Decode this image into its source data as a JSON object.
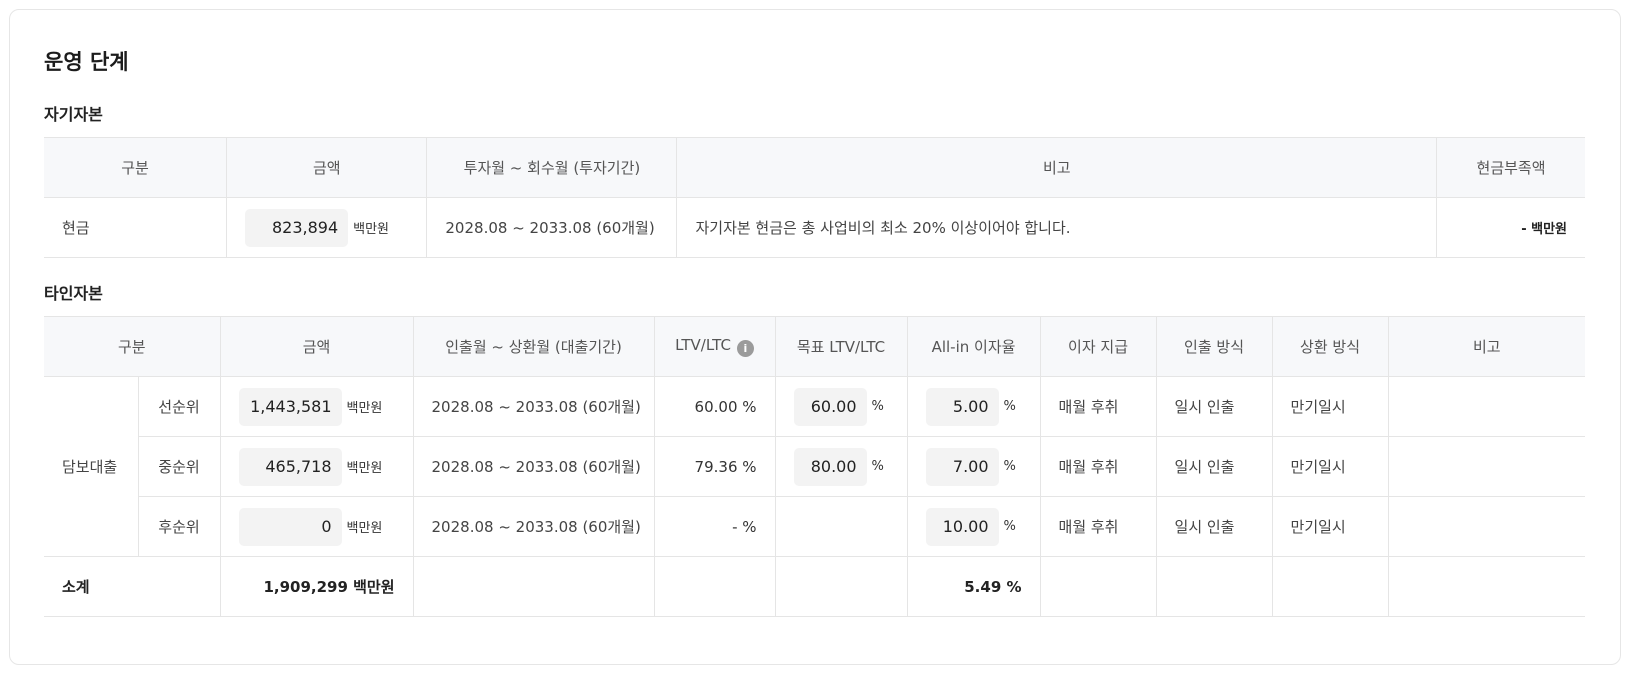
{
  "title": "운영 단계",
  "equity": {
    "section": "자기자본",
    "headers": [
      "구분",
      "금액",
      "투자월 ~ 회수월 (투자기간)",
      "비고",
      "현금부족액"
    ],
    "row": {
      "label": "현금",
      "amount": "823,894",
      "unit": "백만원",
      "period": "2028.08 ~ 2033.08 (60개월)",
      "note": "자기자본 현금은 총 사업비의 최소 20% 이상이어야 합니다.",
      "shortfall": "- 백만원"
    }
  },
  "debt": {
    "section": "타인자본",
    "headers": [
      "구분",
      "금액",
      "인출월 ~ 상환월 (대출기간)",
      "LTV/LTC",
      "목표 LTV/LTC",
      "All-in 이자율",
      "이자 지급",
      "인출 방식",
      "상환 방식",
      "비고"
    ],
    "info_icon": "info-icon",
    "group_label": "담보대출",
    "unit": "백만원",
    "pct": "%",
    "rows": [
      {
        "tranche": "선순위",
        "amount": "1,443,581",
        "period": "2028.08 ~ 2033.08 (60개월)",
        "ltv": "60.00 %",
        "target": "60.00",
        "rate": "5.00",
        "interest": "매월 후취",
        "draw": "일시 인출",
        "repay": "만기일시"
      },
      {
        "tranche": "중순위",
        "amount": "465,718",
        "period": "2028.08 ~ 2033.08 (60개월)",
        "ltv": "79.36 %",
        "target": "80.00",
        "rate": "7.00",
        "interest": "매월 후취",
        "draw": "일시 인출",
        "repay": "만기일시"
      },
      {
        "tranche": "후순위",
        "amount": "0",
        "period": "2028.08 ~ 2033.08 (60개월)",
        "ltv": "- %",
        "rate": "10.00",
        "interest": "매월 후취",
        "draw": "일시 인출",
        "repay": "만기일시"
      }
    ],
    "subtotal": {
      "label": "소계",
      "amount": "1,909,299 백만원",
      "rate": "5.49 %"
    }
  }
}
